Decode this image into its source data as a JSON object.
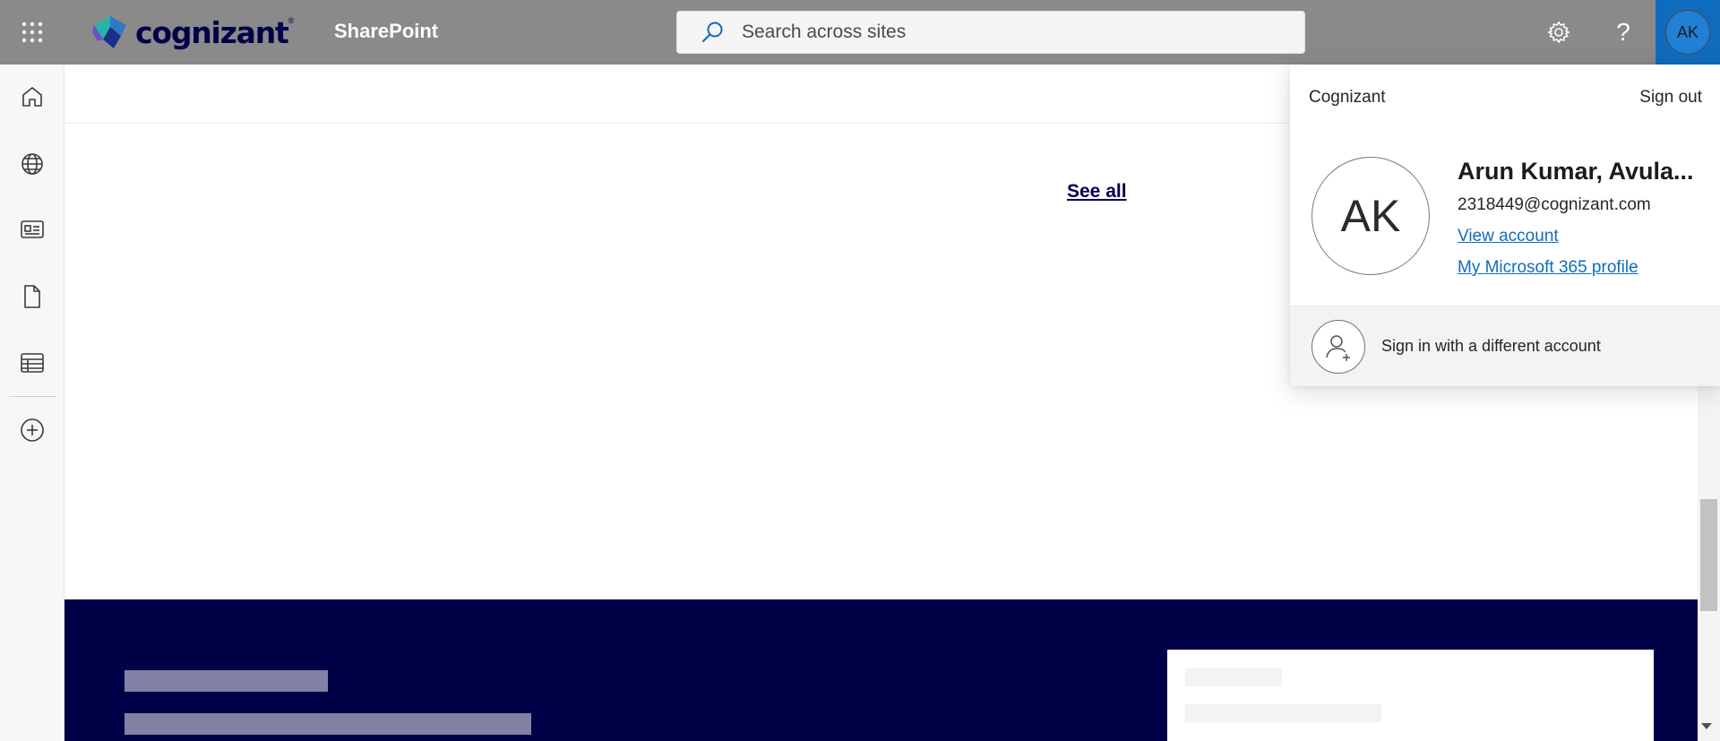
{
  "header": {
    "app_launcher_icon": "waffle-icon",
    "logo_text": "cognizant",
    "logo_trademark": "®",
    "app_name": "SharePoint",
    "search": {
      "placeholder": "Search across sites",
      "icon": "search-icon"
    },
    "settings_icon": "gear-icon",
    "help_label": "?",
    "me_initials": "AK"
  },
  "leftnav": {
    "items": [
      {
        "icon": "home-icon"
      },
      {
        "icon": "globe-icon"
      },
      {
        "icon": "news-icon"
      },
      {
        "icon": "file-icon"
      },
      {
        "icon": "list-icon"
      },
      {
        "icon": "add-circle-icon"
      }
    ]
  },
  "main": {
    "see_all_label": "See all"
  },
  "account_panel": {
    "organization": "Cognizant",
    "sign_out_label": "Sign out",
    "avatar_initials": "AK",
    "name": "Arun Kumar, Avula...",
    "email": "2318449@cognizant.com",
    "view_account_label": "View account",
    "profile_label": "My Microsoft 365 profile",
    "switch_account_label": "Sign in with a different account"
  },
  "colors": {
    "header_bg": "#8a8a8a",
    "brand_navy": "#000048",
    "accent_blue": "#0f6cbd",
    "footer_placeholder": "#8381a3"
  }
}
